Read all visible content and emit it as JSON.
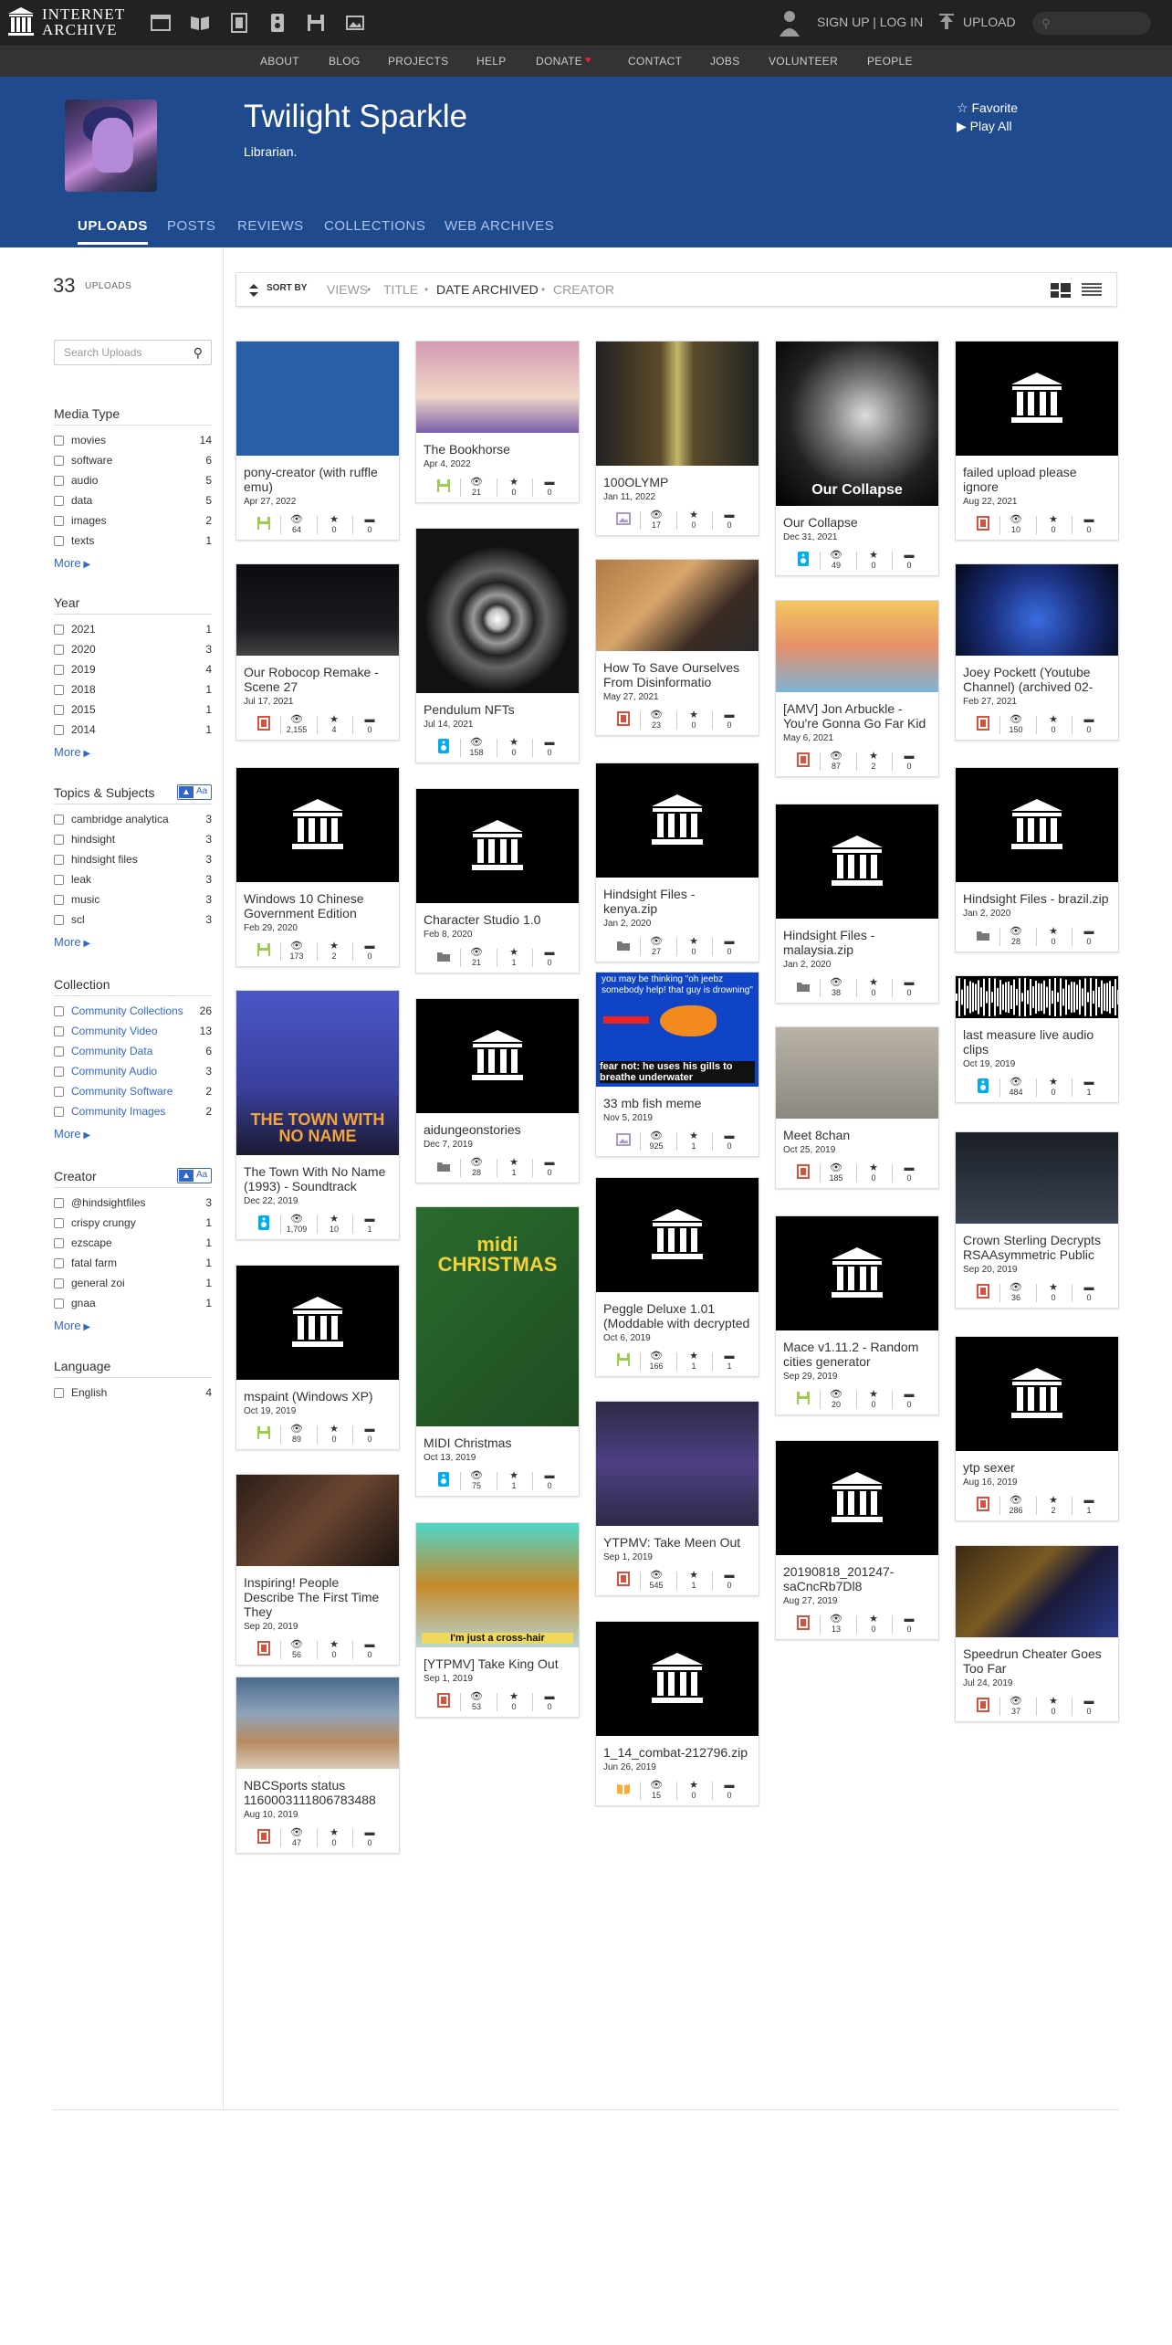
{
  "topbar": {
    "logo_line1": "INTERNET",
    "logo_line2": "ARCHIVE",
    "signup": "SIGN UP | LOG IN",
    "upload": "UPLOAD"
  },
  "nav": [
    "ABOUT",
    "BLOG",
    "PROJECTS",
    "HELP",
    "DONATE",
    "CONTACT",
    "JOBS",
    "VOLUNTEER",
    "PEOPLE"
  ],
  "profile": {
    "name": "Twilight Sparkle",
    "subtitle": "Librarian.",
    "favorite": "Favorite",
    "play_all": "Play All"
  },
  "tabs": [
    "UPLOADS",
    "POSTS",
    "REVIEWS",
    "COLLECTIONS",
    "WEB ARCHIVES"
  ],
  "side": {
    "count": "33",
    "count_label": "UPLOADS",
    "search_placeholder": "Search Uploads",
    "media_type": {
      "title": "Media Type",
      "items": [
        [
          "movies",
          "14"
        ],
        [
          "software",
          "6"
        ],
        [
          "audio",
          "5"
        ],
        [
          "data",
          "5"
        ],
        [
          "images",
          "2"
        ],
        [
          "texts",
          "1"
        ]
      ],
      "more": "More"
    },
    "year": {
      "title": "Year",
      "items": [
        [
          "2021",
          "1"
        ],
        [
          "2020",
          "3"
        ],
        [
          "2019",
          "4"
        ],
        [
          "2018",
          "1"
        ],
        [
          "2015",
          "1"
        ],
        [
          "2014",
          "1"
        ]
      ],
      "more": "More"
    },
    "topics": {
      "title": "Topics & Subjects",
      "toggle": "Aa",
      "items": [
        [
          "cambridge analytica",
          "3"
        ],
        [
          "hindsight",
          "3"
        ],
        [
          "hindsight files",
          "3"
        ],
        [
          "leak",
          "3"
        ],
        [
          "music",
          "3"
        ],
        [
          "scl",
          "3"
        ]
      ],
      "more": "More"
    },
    "collection": {
      "title": "Collection",
      "items": [
        [
          "Community Collections",
          "26"
        ],
        [
          "Community Video",
          "13"
        ],
        [
          "Community Data",
          "6"
        ],
        [
          "Community Audio",
          "3"
        ],
        [
          "Community Software",
          "2"
        ],
        [
          "Community Images",
          "2"
        ]
      ],
      "more": "More"
    },
    "creator": {
      "title": "Creator",
      "toggle": "Aa",
      "items": [
        [
          "@hindsightfiles",
          "3"
        ],
        [
          "crispy crungy",
          "1"
        ],
        [
          "ezscape",
          "1"
        ],
        [
          "fatal farm",
          "1"
        ],
        [
          "general zoi",
          "1"
        ],
        [
          "gnaa",
          "1"
        ]
      ],
      "more": "More"
    },
    "language": {
      "title": "Language",
      "items": [
        [
          "English",
          "4"
        ]
      ]
    }
  },
  "sort": {
    "label": "SORT BY",
    "options": [
      "VIEWS",
      "TITLE",
      "DATE ARCHIVED",
      "CREATOR"
    ],
    "active": "DATE ARCHIVED"
  },
  "cards": [
    {
      "title": "pony-creator (with ruffle emu)",
      "date": "Apr 27, 2022",
      "views": "64",
      "favs": "0",
      "reviews": "0",
      "type": "software",
      "thumb": "blue"
    },
    {
      "title": "The Bookhorse",
      "date": "Apr 4, 2022",
      "views": "21",
      "favs": "0",
      "reviews": "0",
      "type": "software",
      "thumb": "pony"
    },
    {
      "title": "100OLYMP",
      "date": "Jan 11, 2022",
      "views": "17",
      "favs": "0",
      "reviews": "0",
      "type": "image",
      "thumb": "olymp"
    },
    {
      "title": "Our Collapse",
      "date": "Dec 31, 2021",
      "views": "49",
      "favs": "0",
      "reviews": "0",
      "type": "audio",
      "thumb": "collapse",
      "overlay": "Our Collapse"
    },
    {
      "title": "failed upload please ignore",
      "date": "Aug 22, 2021",
      "views": "10",
      "favs": "0",
      "reviews": "0",
      "type": "movie",
      "thumb": "black"
    },
    {
      "title": "Our Robocop Remake - Scene 27",
      "date": "Jul 17, 2021",
      "views": "2,155",
      "favs": "4",
      "reviews": "0",
      "type": "movie",
      "thumb": "dark"
    },
    {
      "title": "Pendulum NFTs",
      "date": "Jul 14, 2021",
      "views": "158",
      "favs": "0",
      "reviews": "0",
      "type": "audio",
      "thumb": "pendulum"
    },
    {
      "title": "How To Save Ourselves From Disinformatio",
      "date": "May 27, 2021",
      "views": "23",
      "favs": "0",
      "reviews": "0",
      "type": "movie",
      "thumb": "woman"
    },
    {
      "title": "[AMV] Jon Arbuckle - You're Gonna Go Far Kid",
      "date": "May 6, 2021",
      "views": "87",
      "favs": "2",
      "reviews": "0",
      "type": "movie",
      "thumb": "amv"
    },
    {
      "title": "Joey Pockett (Youtube Channel) (archived 02-",
      "date": "Feb 27, 2021",
      "views": "150",
      "favs": "0",
      "reviews": "0",
      "type": "movie",
      "thumb": "stage"
    },
    {
      "title": "Windows 10 Chinese Government Edition",
      "date": "Feb 29, 2020",
      "views": "173",
      "favs": "2",
      "reviews": "0",
      "type": "software",
      "thumb": "black"
    },
    {
      "title": "Character Studio 1.0",
      "date": "Feb 8, 2020",
      "views": "21",
      "favs": "1",
      "reviews": "0",
      "type": "data",
      "thumb": "black"
    },
    {
      "title": "Hindsight Files - kenya.zip",
      "date": "Jan 2, 2020",
      "views": "27",
      "favs": "0",
      "reviews": "0",
      "type": "data",
      "thumb": "black"
    },
    {
      "title": "Hindsight Files - malaysia.zip",
      "date": "Jan 2, 2020",
      "views": "38",
      "favs": "0",
      "reviews": "0",
      "type": "data",
      "thumb": "black"
    },
    {
      "title": "Hindsight Files - brazil.zip",
      "date": "Jan 2, 2020",
      "views": "28",
      "favs": "0",
      "reviews": "0",
      "type": "data",
      "thumb": "black"
    },
    {
      "title": "The Town With No Name (1993) - Soundtrack",
      "date": "Dec 22, 2019",
      "views": "1,709",
      "favs": "10",
      "reviews": "1",
      "type": "audio",
      "thumb": "town",
      "overlay": "THE TOWN WITH NO NAME"
    },
    {
      "title": "aidungeonstories",
      "date": "Dec 7, 2019",
      "views": "28",
      "favs": "1",
      "reviews": "0",
      "type": "data",
      "thumb": "black"
    },
    {
      "title": "33 mb fish meme",
      "date": "Nov 5, 2019",
      "views": "925",
      "favs": "1",
      "reviews": "0",
      "type": "image",
      "thumb": "fish",
      "overlay": "you may be thinking \"oh jeebz somebody help! that guy is drowning\"",
      "overlay2": "fear not: he uses his gills to breathe underwater"
    },
    {
      "title": "Meet 8chan",
      "date": "Oct 25, 2019",
      "views": "185",
      "favs": "0",
      "reviews": "0",
      "type": "movie",
      "thumb": "meet"
    },
    {
      "title": "last measure live audio clips",
      "date": "Oct 19, 2019",
      "views": "484",
      "favs": "0",
      "reviews": "1",
      "type": "audio",
      "thumb": "wave"
    },
    {
      "title": "mspaint (Windows XP)",
      "date": "Oct 19, 2019",
      "views": "89",
      "favs": "0",
      "reviews": "0",
      "type": "software",
      "thumb": "black"
    },
    {
      "title": "MIDI Christmas",
      "date": "Oct 13, 2019",
      "views": "75",
      "favs": "1",
      "reviews": "0",
      "type": "audio",
      "thumb": "midi",
      "overlay": "midi CHRISTMAS"
    },
    {
      "title": "Peggle Deluxe 1.01 (Moddable with decrypted",
      "date": "Oct 6, 2019",
      "views": "166",
      "favs": "1",
      "reviews": "1",
      "type": "software",
      "thumb": "black"
    },
    {
      "title": "Mace v1.11.2 - Random cities generator",
      "date": "Sep 29, 2019",
      "views": "20",
      "favs": "0",
      "reviews": "0",
      "type": "software",
      "thumb": "black"
    },
    {
      "title": "Crown Sterling Decrypts RSAAsymmetric Public",
      "date": "Sep 20, 2019",
      "views": "36",
      "favs": "0",
      "reviews": "0",
      "type": "movie",
      "thumb": "crown"
    },
    {
      "title": "Inspiring! People Describe The First Time They",
      "date": "Sep 20, 2019",
      "views": "56",
      "favs": "0",
      "reviews": "0",
      "type": "movie",
      "thumb": "face"
    },
    {
      "title": "[YTPMV] Take King Out",
      "date": "Sep 1, 2019",
      "views": "53",
      "favs": "0",
      "reviews": "0",
      "type": "movie",
      "thumb": "king",
      "overlay": "I'm just a cross-hair"
    },
    {
      "title": "YTPMV: Take Meen Out",
      "date": "Sep 1, 2019",
      "views": "545",
      "favs": "1",
      "reviews": "0",
      "type": "movie",
      "thumb": "wizard"
    },
    {
      "title": "20190818_201247-saCncRb7Dl8",
      "date": "Aug 27, 2019",
      "views": "13",
      "favs": "0",
      "reviews": "0",
      "type": "movie",
      "thumb": "black"
    },
    {
      "title": "ytp sexer",
      "date": "Aug 16, 2019",
      "views": "286",
      "favs": "2",
      "reviews": "1",
      "type": "movie",
      "thumb": "black"
    },
    {
      "title": "NBCSports status 1160003111806783488",
      "date": "Aug 10, 2019",
      "views": "47",
      "favs": "0",
      "reviews": "0",
      "type": "movie",
      "thumb": "gym"
    },
    {
      "title": "1_14_combat-212796.zip",
      "date": "Jun 26, 2019",
      "views": "15",
      "favs": "0",
      "reviews": "0",
      "type": "text",
      "thumb": "black"
    },
    {
      "title": "Speedrun Cheater Goes Too Far",
      "date": "Jul 24, 2019",
      "views": "37",
      "favs": "0",
      "reviews": "0",
      "type": "movie",
      "thumb": "yugioh"
    }
  ],
  "colors": {
    "hero": "#1f4b8e",
    "link": "#3366cc",
    "movie": "#d7513e",
    "software": "#9ecc4f",
    "audio": "#00adef",
    "image": "#aa99c9",
    "data": "#777777",
    "text": "#faab3c"
  }
}
